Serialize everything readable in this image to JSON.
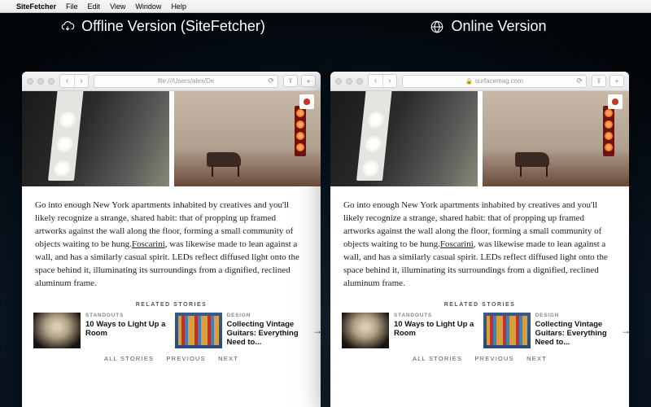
{
  "menubar": {
    "app": "SiteFetcher",
    "items": [
      "File",
      "Edit",
      "View",
      "Window",
      "Help"
    ]
  },
  "labels": {
    "offline": "Offline Version (SiteFetcher)",
    "online": "Online Version"
  },
  "browser": {
    "offline_url": "file:///Users/alex/De",
    "online_url": "surfacemag.com"
  },
  "article": {
    "body_pre": "Go into enough New York apartments inhabited by creatives and you'll likely recognize a strange, shared habit: that of propping up framed artworks against the wall along the floor, forming a small community of objects waiting to be hung.",
    "link": "Foscarini",
    "body_post": ", was likewise made to lean against a wall, and has a similarly casual spirit. LEDs reflect diffused light onto the space behind it, illuminating its surroundings from a dignified, reclined aluminum frame."
  },
  "related": {
    "heading": "RELATED STORIES",
    "cards": [
      {
        "cat": "STANDOUTS",
        "title": "10 Ways to Light Up a Room"
      },
      {
        "cat": "DESIGN",
        "title": "Collecting Vintage Guitars: Everything Need to..."
      }
    ],
    "pager": {
      "all": "ALL STORIES",
      "prev": "PREVIOUS",
      "next": "NEXT"
    }
  }
}
